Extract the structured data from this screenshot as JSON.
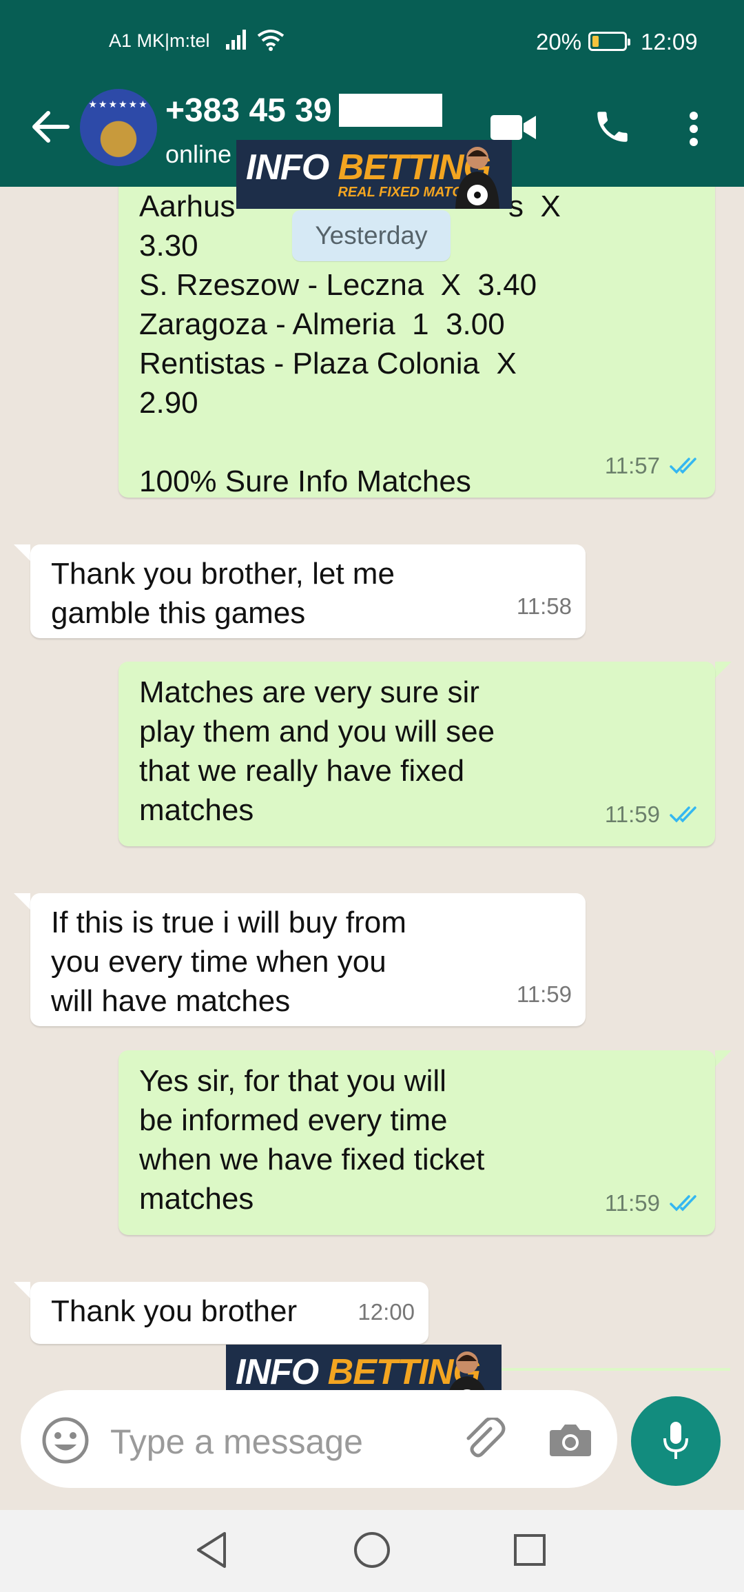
{
  "status_bar": {
    "carrier": "A1 MK|m:tel",
    "battery_percent": "20%",
    "battery_level": 0.2,
    "time": "12:09"
  },
  "header": {
    "contact_name": "+383 45 39",
    "status": "online"
  },
  "chat": {
    "date_label": "Yesterday",
    "messages": [
      {
        "direction": "out",
        "lines": [
          "Aarhus",
          "s  X",
          "3.30",
          "S. Rzeszow - Leczna  X  3.40",
          "Zaragoza - Almeria  1  3.00",
          "Rentistas - Plaza Colonia  X",
          "2.90",
          "",
          "100% Sure Info Matches"
        ],
        "time": "11:57",
        "read": true
      },
      {
        "direction": "in",
        "lines": [
          "Thank you brother, let me",
          "gamble this games"
        ],
        "time": "11:58"
      },
      {
        "direction": "out",
        "lines": [
          "Matches are very sure sir",
          "play them and you will see",
          "that we really have fixed",
          "matches"
        ],
        "time": "11:59",
        "read": true
      },
      {
        "direction": "in",
        "lines": [
          "If this is true i will buy from",
          "you every time when you",
          "will have matches"
        ],
        "time": "11:59"
      },
      {
        "direction": "out",
        "lines": [
          "Yes sir, for that you will",
          "be informed every time",
          "when we have fixed ticket",
          "matches"
        ],
        "time": "11:59",
        "read": true
      },
      {
        "direction": "in",
        "lines": [
          "Thank you brother"
        ],
        "time": "12:00"
      }
    ]
  },
  "watermark": {
    "title_part1": "INFO ",
    "title_part2": "BETTING",
    "subtitle": "REAL FIXED MATCHES"
  },
  "composer": {
    "placeholder": "Type a message"
  },
  "icons": {
    "back": "arrow-left-icon",
    "video": "video-call-icon",
    "call": "phone-icon",
    "menu": "more-vertical-icon",
    "emoji": "emoji-icon",
    "attach": "paperclip-icon",
    "camera": "camera-icon",
    "mic": "microphone-icon"
  },
  "colors": {
    "header": "#075e54",
    "outgoing_bubble": "#dcf8c6",
    "incoming_bubble": "#ffffff",
    "mic_button": "#128c7e",
    "read_tick": "#34b7f1"
  }
}
